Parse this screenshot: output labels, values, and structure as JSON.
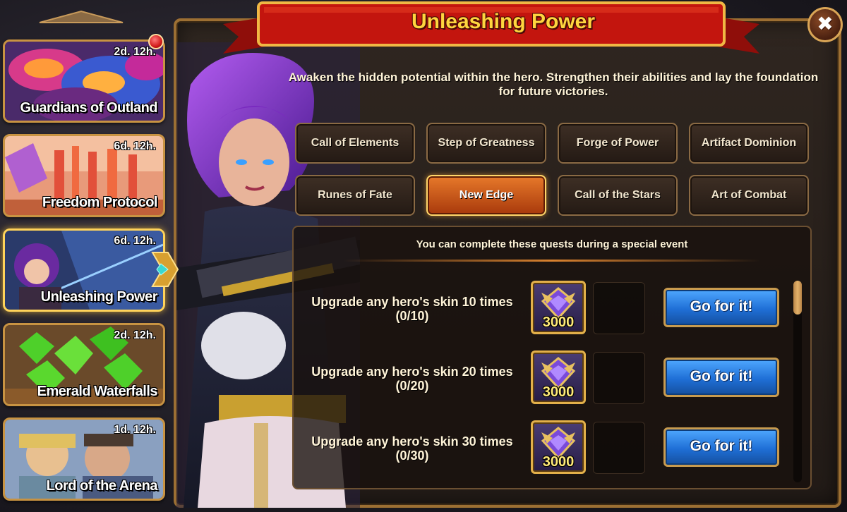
{
  "title": "Unleashing Power",
  "close_label": "✖",
  "description": "Awaken the hidden potential within the hero. Strengthen their abilities and lay the foundation for future victories.",
  "events": [
    {
      "name": "Guardians of Outland",
      "timer": "2d. 12h.",
      "notification": true
    },
    {
      "name": "Freedom Protocol",
      "timer": "6d. 12h."
    },
    {
      "name": "Unleashing Power",
      "timer": "6d. 12h.",
      "selected": true
    },
    {
      "name": "Emerald Waterfalls",
      "timer": "2d. 12h."
    },
    {
      "name": "Lord of the Arena",
      "timer": "1d. 12h."
    }
  ],
  "tabs": [
    {
      "label": "Call of Elements"
    },
    {
      "label": "Step of Greatness"
    },
    {
      "label": "Forge of Power"
    },
    {
      "label": "Artifact Dominion"
    },
    {
      "label": "Runes of Fate"
    },
    {
      "label": "New Edge",
      "active": true
    },
    {
      "label": "Call of the Stars"
    },
    {
      "label": "Art of Combat"
    }
  ],
  "quest_note": "You can complete these quests during a special event",
  "quests": [
    {
      "text": "Upgrade any hero's skin 10 times",
      "progress": "(0/10)",
      "reward_qty": "3000",
      "button": "Go for it!"
    },
    {
      "text": "Upgrade any hero's skin 20 times",
      "progress": "(0/20)",
      "reward_qty": "3000",
      "button": "Go for it!"
    },
    {
      "text": "Upgrade any hero's skin 30 times",
      "progress": "(0/30)",
      "reward_qty": "3000",
      "button": "Go for it!"
    }
  ],
  "colors": {
    "title": "#ffd53e",
    "banner": "#c3150e",
    "active_tab": "#e7792a",
    "go_button": "#1f6fd6",
    "gold_border": "#c89342"
  }
}
